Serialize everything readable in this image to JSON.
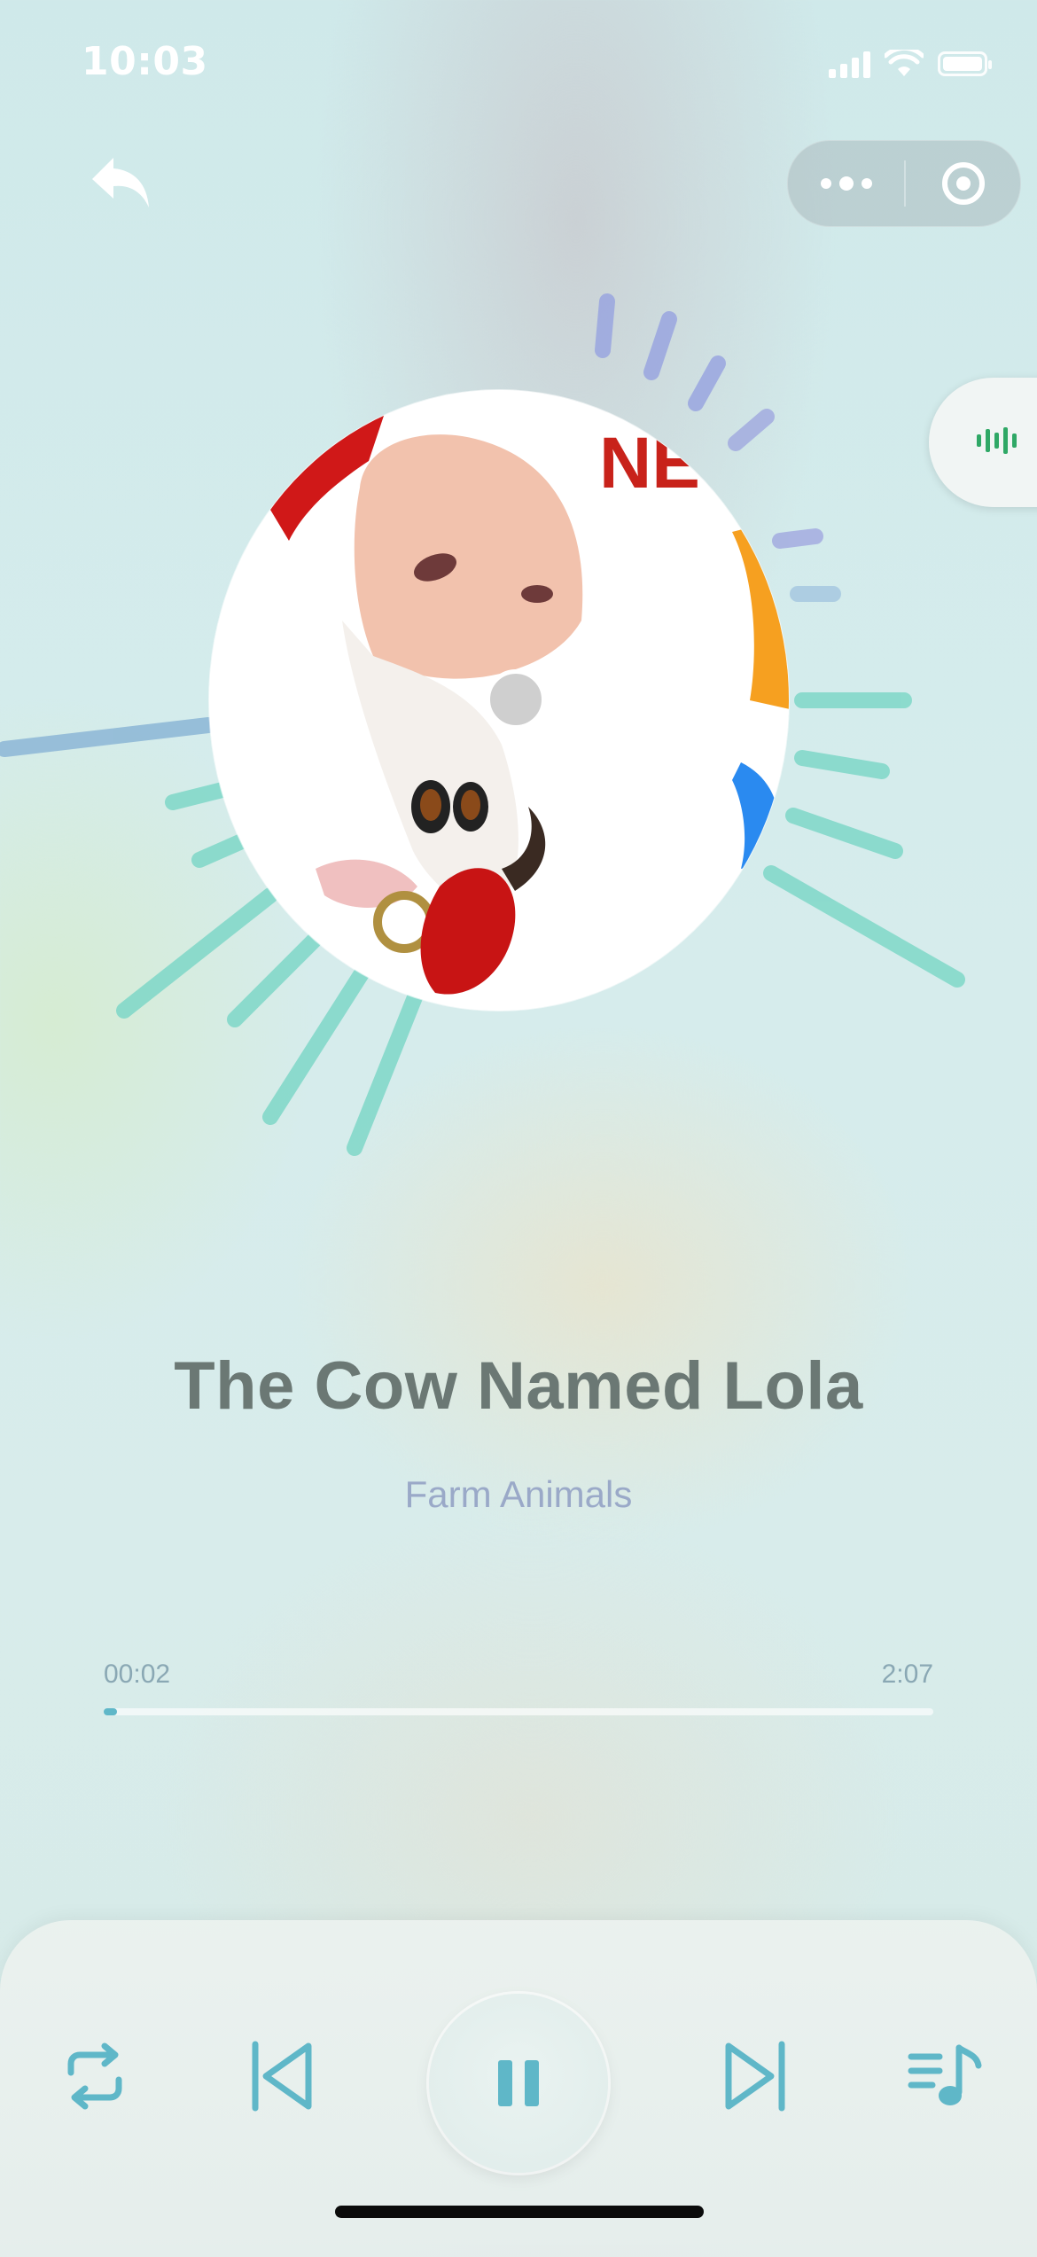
{
  "status_bar": {
    "time": "10:03"
  },
  "nav": {
    "back_icon": "back-arrow-icon",
    "more_icon": "more-dots-icon",
    "close_icon": "target-circle-icon"
  },
  "side_tab": {
    "icon": "audio-wave-icon",
    "color": "#2fa866"
  },
  "album": {
    "title_art_text": "NEW!"
  },
  "track": {
    "title": "The Cow Named Lola",
    "artist": "Farm Animals"
  },
  "progress": {
    "current": "00:02",
    "total": "2:07",
    "fraction": 0.016
  },
  "controls": {
    "repeat_icon": "repeat-icon",
    "previous_icon": "skip-previous-icon",
    "play_state": "playing",
    "play_pause_icon": "pause-icon",
    "next_icon": "skip-next-icon",
    "playlist_icon": "playlist-icon"
  },
  "colors": {
    "accent": "#5fb7c8",
    "title": "#6b7874",
    "artist": "#9aa9c8",
    "visualizer_teal": "#7fd8c8",
    "visualizer_blue": "#9aa6e0"
  }
}
